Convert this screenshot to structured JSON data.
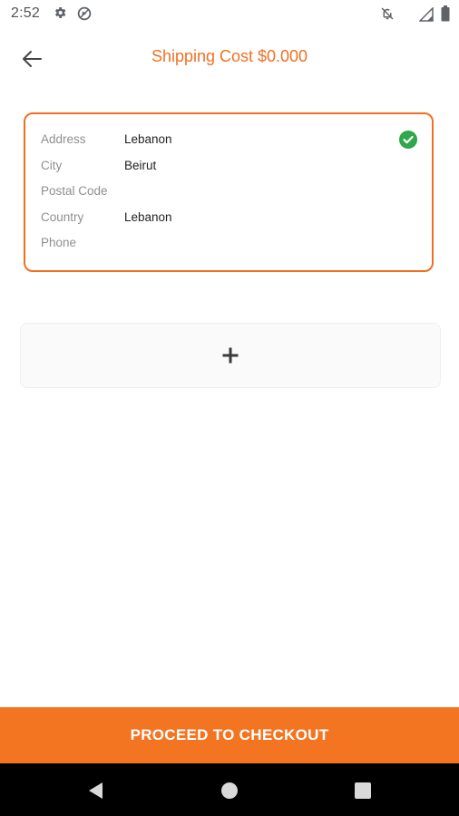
{
  "status_bar": {
    "time": "2:52",
    "icons": [
      "gear-icon",
      "sync-icon",
      "notifications-off-icon",
      "signal-icon",
      "battery-icon"
    ]
  },
  "header": {
    "title": "Shipping Cost $0.000",
    "back_icon": "arrow-left-icon"
  },
  "address_card": {
    "selected": true,
    "rows": [
      {
        "label": "Address",
        "value": "Lebanon"
      },
      {
        "label": "City",
        "value": "Beirut"
      },
      {
        "label": "Postal Code",
        "value": ""
      },
      {
        "label": "Country",
        "value": "Lebanon"
      },
      {
        "label": "Phone",
        "value": ""
      }
    ]
  },
  "add_card": {
    "icon": "plus-icon"
  },
  "checkout": {
    "label": "PROCEED TO CHECKOUT"
  },
  "nav_bar": {
    "icons": [
      "nav-back-icon",
      "nav-home-icon",
      "nav-recents-icon"
    ]
  },
  "colors": {
    "accent": "#f07022",
    "checkout_bg": "#f37421",
    "check_green": "#2ea84a",
    "nav_bg": "#000000"
  }
}
